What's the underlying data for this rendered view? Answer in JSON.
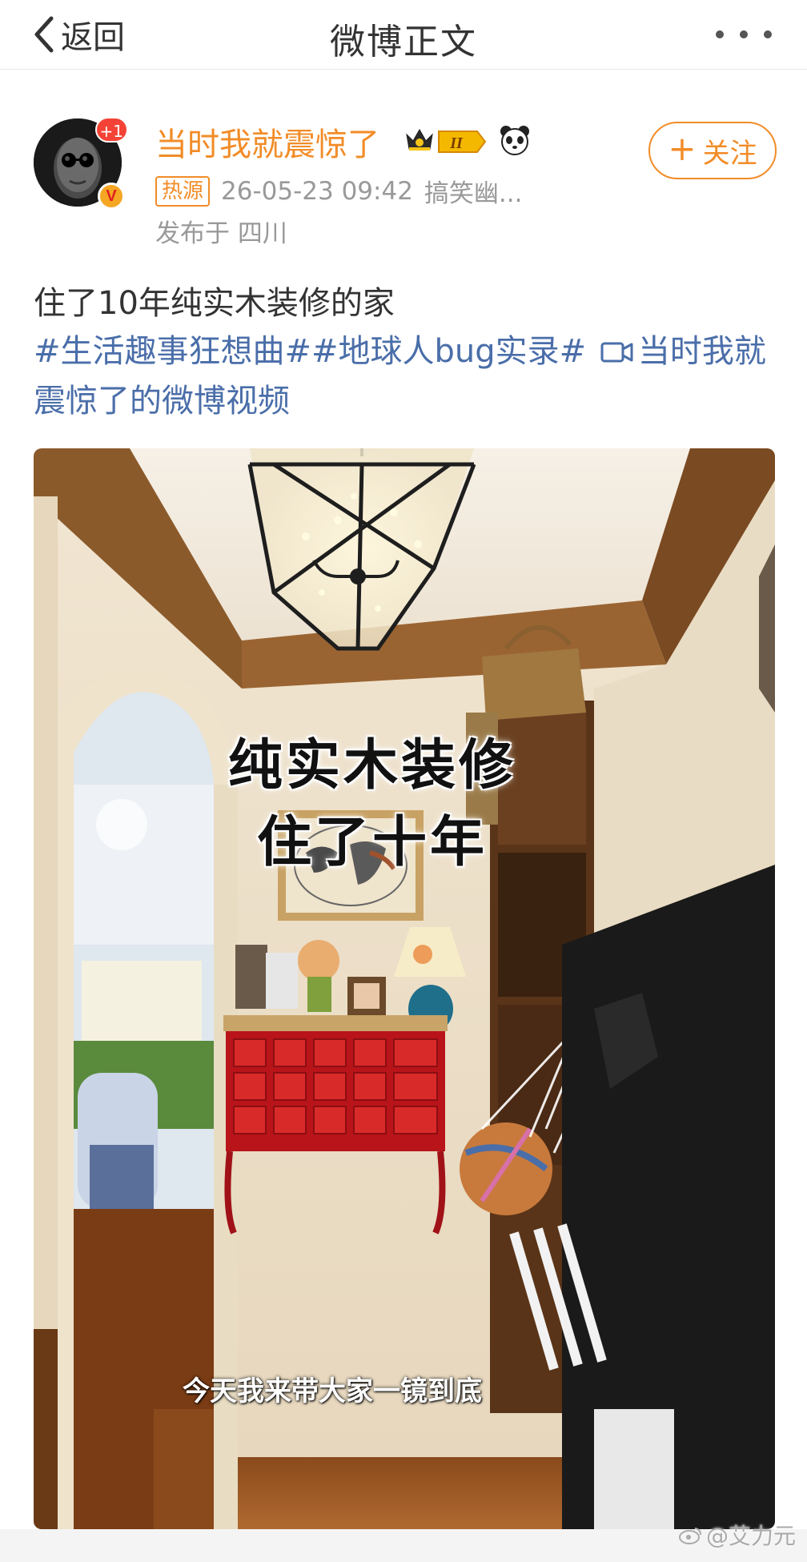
{
  "nav": {
    "back_label": "返回",
    "title": "微博正文"
  },
  "author": {
    "name": "当时我就震惊了",
    "avatar_plus_badge": "+1",
    "verified_mark": "V",
    "level_text": "II",
    "hot_tag": "热源",
    "timestamp": "26-05-23 09:42",
    "source": "搞笑幽...",
    "location": "发布于 四川",
    "follow_label": "关注"
  },
  "post": {
    "text": "住了10年纯实木装修的家",
    "hashtag_1": "#生活趣事狂想曲#",
    "hashtag_2": "#地球人bug实录#",
    "video_link": "当时我就震惊了的微博视频"
  },
  "video": {
    "overlay_line_1": "纯实木装修",
    "overlay_line_2": "住了十年",
    "subtitle": "今天我来带大家一镜到底"
  },
  "watermark": "@艾力元",
  "colors": {
    "accent_orange": "#f28c28",
    "link_blue": "#4a6ea9",
    "meta_gray": "#999999"
  },
  "icons": [
    "back-chevron-icon",
    "more-dots-icon",
    "crown-icon",
    "level-badge-icon",
    "panda-icon",
    "plus-icon",
    "video-camera-icon",
    "weibo-logo-icon"
  ]
}
